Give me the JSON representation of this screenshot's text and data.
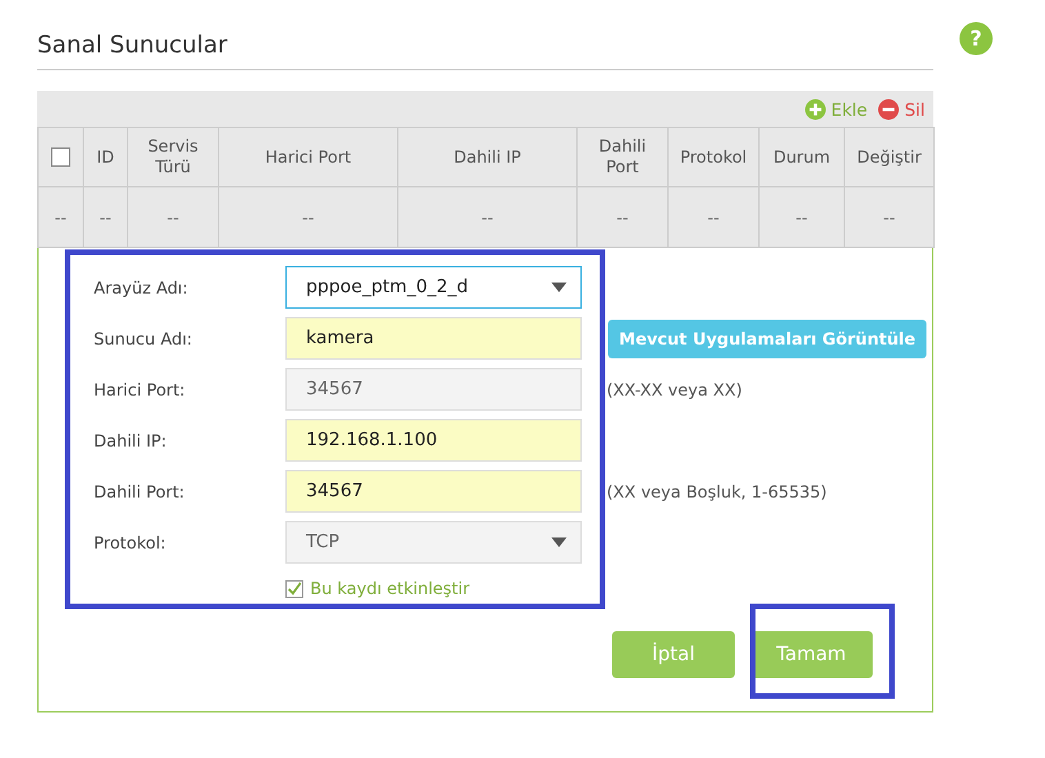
{
  "title": "Sanal Sunucular",
  "help": "?",
  "toolbar": [
    {
      "kind": "add",
      "label": "Ekle"
    },
    {
      "kind": "delete",
      "label": "Sil"
    }
  ],
  "table": {
    "columns": [
      {
        "kind": "checkbox",
        "checked": false
      },
      {
        "kind": "text",
        "label": "ID"
      },
      {
        "kind": "text",
        "label": "Servis Türü"
      },
      {
        "kind": "text",
        "label": "Harici Port"
      },
      {
        "kind": "text",
        "label": "Dahili IP"
      },
      {
        "kind": "text",
        "label": "Dahili Port"
      },
      {
        "kind": "text",
        "label": "Protokol"
      },
      {
        "kind": "text",
        "label": "Durum"
      },
      {
        "kind": "text",
        "label": "Değiştir"
      }
    ],
    "rows": [
      {
        "cells": [
          "--",
          "--",
          "--",
          "--",
          "--",
          "--",
          "--",
          "--",
          "--"
        ]
      }
    ]
  },
  "form": {
    "highlighted": true,
    "fields": [
      {
        "kind": "select",
        "label": "Arayüz Adı:",
        "value": "pppoe_ptm_0_2_d",
        "focused": true,
        "disabled": false
      },
      {
        "kind": "text",
        "label": "Sunucu Adı:",
        "value": "kamera",
        "focused": false,
        "disabled": false,
        "button": "Mevcut Uygulamaları Görüntüle"
      },
      {
        "kind": "text",
        "label": "Harici Port:",
        "value": "34567",
        "focused": false,
        "disabled": true,
        "hint": "(XX-XX veya XX)"
      },
      {
        "kind": "text",
        "label": "Dahili IP:",
        "value": "192.168.1.100",
        "focused": false,
        "disabled": false
      },
      {
        "kind": "text",
        "label": "Dahili Port:",
        "value": "34567",
        "focused": false,
        "disabled": false,
        "hint": "(XX veya Boşluk, 1-65535)"
      },
      {
        "kind": "select",
        "label": "Protokol:",
        "value": "TCP",
        "focused": false,
        "disabled": true
      }
    ],
    "enable": {
      "label": "Bu kaydı etkinleştir",
      "checked": true
    },
    "buttons": [
      {
        "label": "İptal",
        "highlighted": false
      },
      {
        "label": "Tamam",
        "highlighted": true
      }
    ]
  }
}
